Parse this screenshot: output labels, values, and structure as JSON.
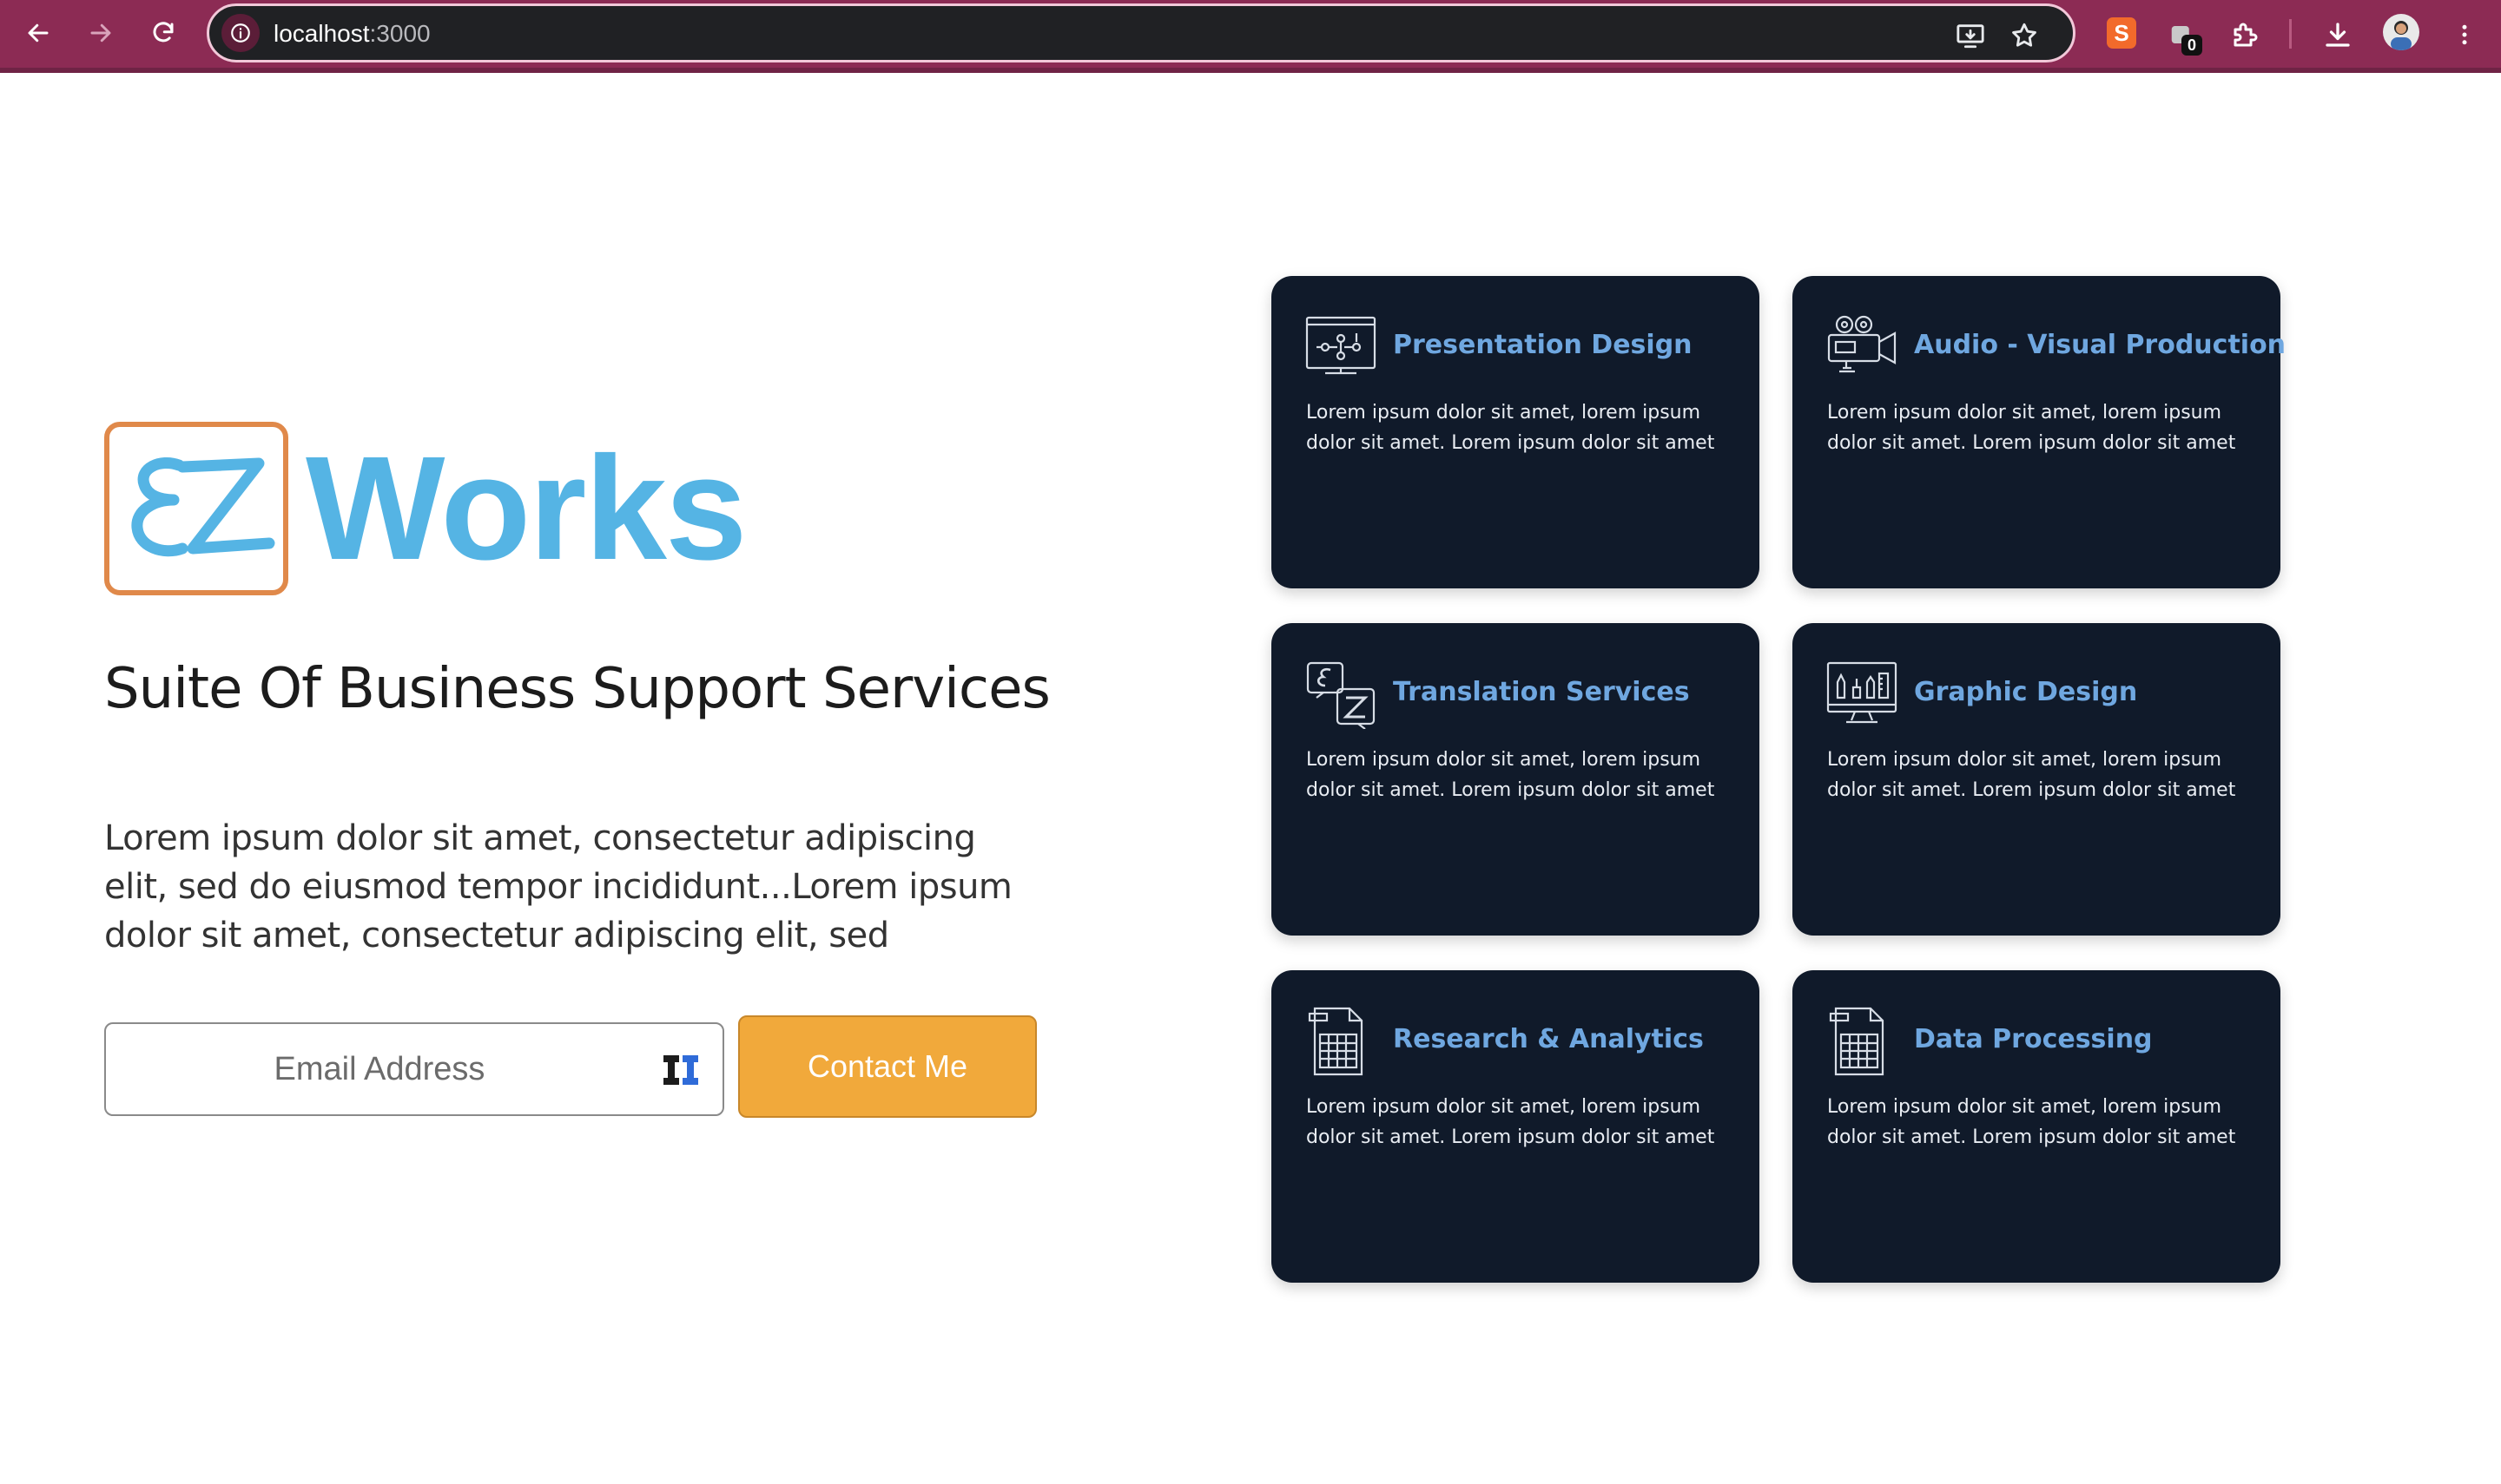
{
  "browser": {
    "url_host": "localhost",
    "url_port": ":3000",
    "extension_badge": "0"
  },
  "hero": {
    "logo_text": "Works",
    "headline": "Suite Of Business Support Services",
    "lead": "Lorem ipsum dolor sit amet, consectetur adipiscing elit, sed do eiusmod tempor incididunt...Lorem ipsum dolor sit amet, consectetur adipiscing elit, sed",
    "email_placeholder": "Email Address",
    "email_value": "",
    "cta_label": "Contact Me"
  },
  "services": [
    {
      "title": "Presentation Design",
      "icon": "presentation-board-icon",
      "desc": "Lorem ipsum dolor sit amet, lorem ipsum dolor sit amet. Lorem ipsum dolor sit amet"
    },
    {
      "title": "Audio - Visual Production",
      "icon": "video-camera-icon",
      "desc": "Lorem ipsum dolor sit amet, lorem ipsum dolor sit amet. Lorem ipsum dolor sit amet"
    },
    {
      "title": "Translation Services",
      "icon": "translation-icon",
      "desc": "Lorem ipsum dolor sit amet, lorem ipsum dolor sit amet. Lorem ipsum dolor sit amet"
    },
    {
      "title": "Graphic Design",
      "icon": "design-tools-icon",
      "desc": "Lorem ipsum dolor sit amet, lorem ipsum dolor sit amet. Lorem ipsum dolor sit amet"
    },
    {
      "title": "Research & Analytics",
      "icon": "spreadsheet-document-icon",
      "desc": "Lorem ipsum dolor sit amet, lorem ipsum dolor sit amet. Lorem ipsum dolor sit amet"
    },
    {
      "title": "Data Processing",
      "icon": "data-table-document-icon",
      "desc": "Lorem ipsum dolor sit amet, lorem ipsum dolor sit amet. Lorem ipsum dolor sit amet"
    }
  ],
  "colors": {
    "chrome_bg": "#8c2b54",
    "card_bg": "#101a2a",
    "card_title": "#6fa7e0",
    "logo_blue": "#55b4e4",
    "logo_orange": "#e0894a",
    "cta_bg": "#f1a93b"
  }
}
